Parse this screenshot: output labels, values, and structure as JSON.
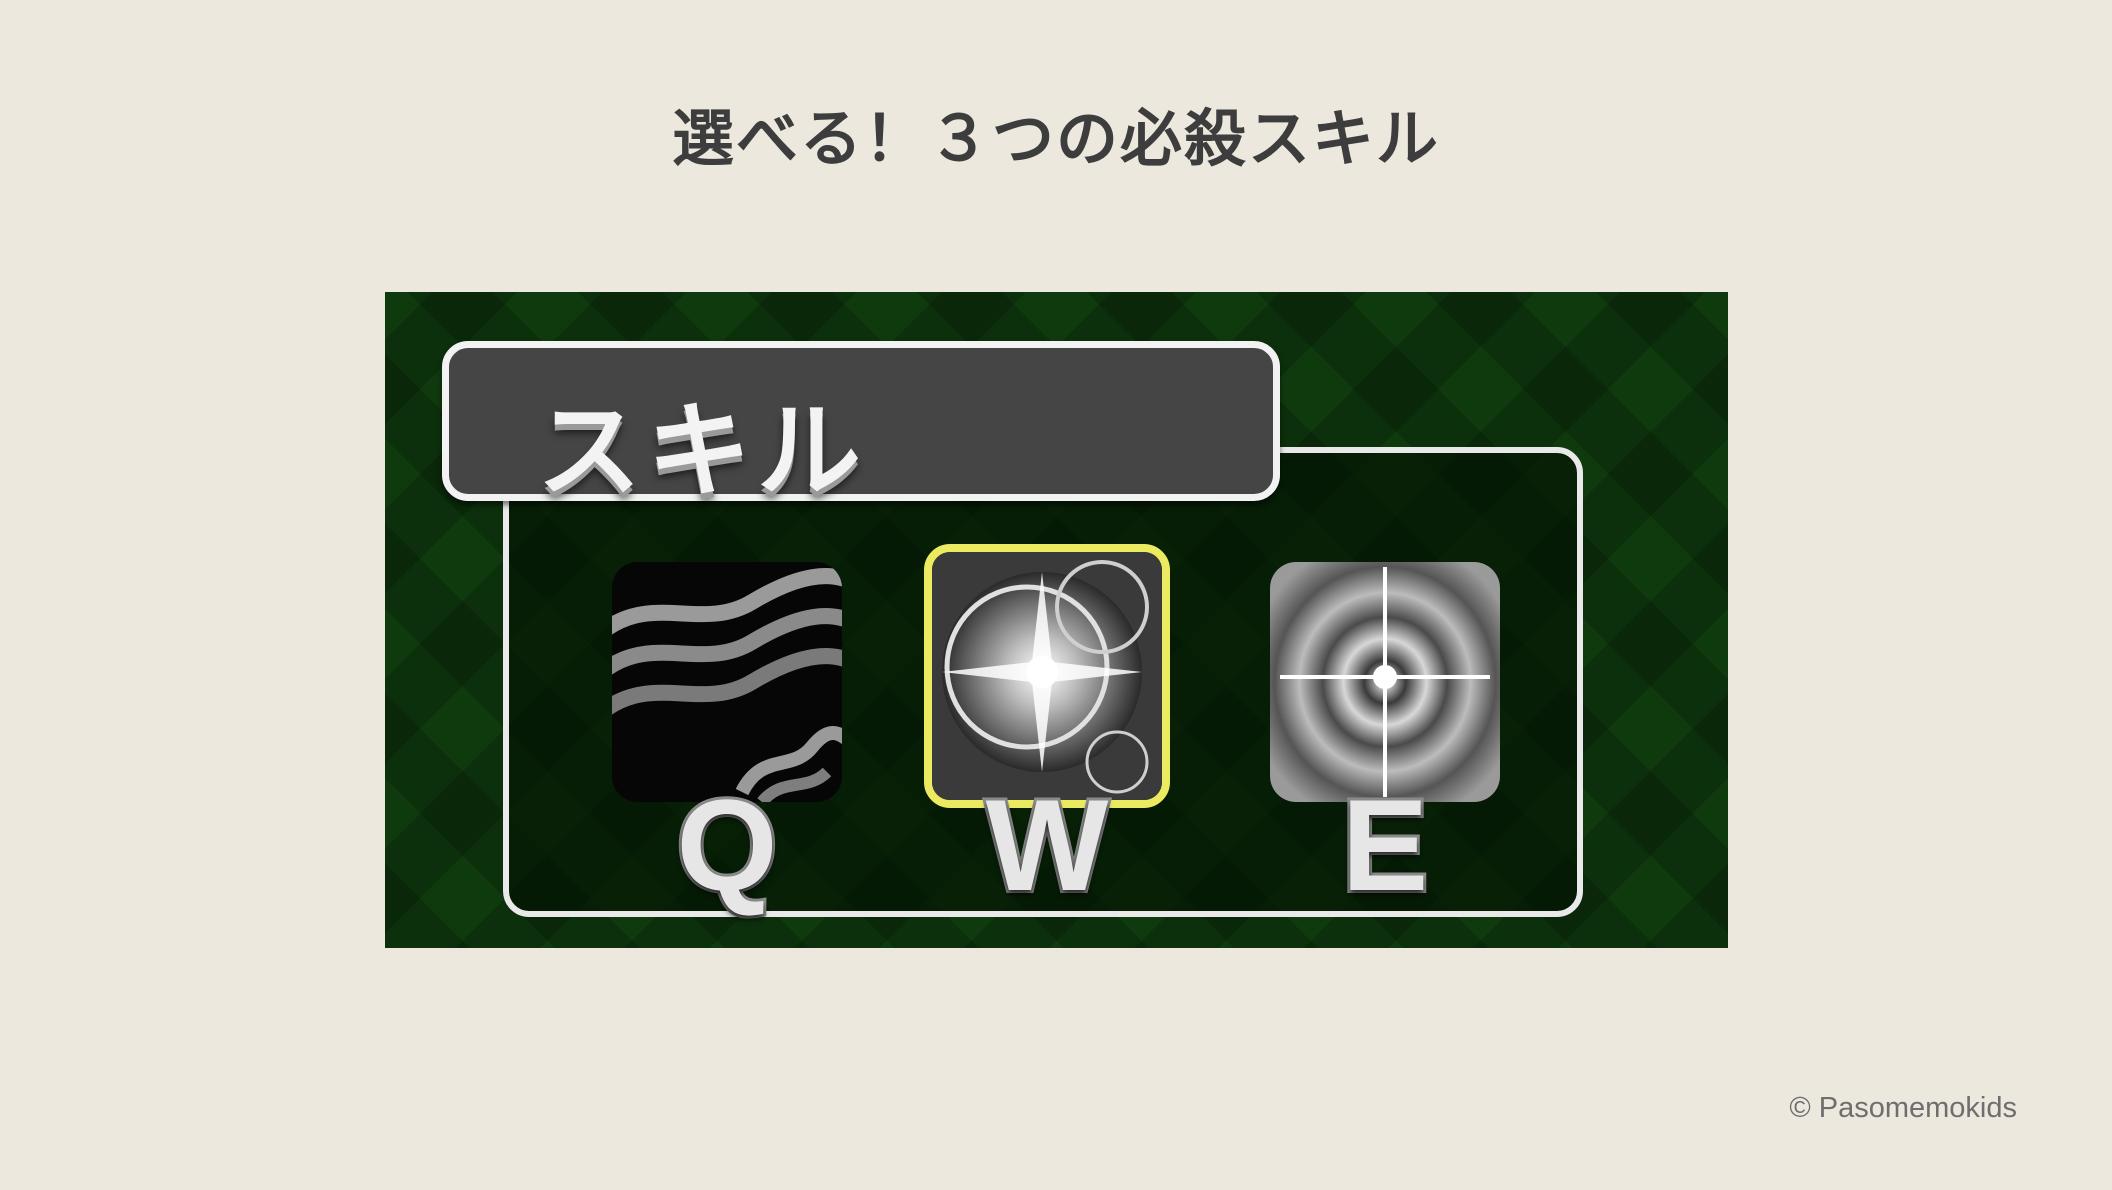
{
  "page": {
    "title": "選べる！３つの必殺スキル",
    "copyright": "©  Pasomemokids"
  },
  "game": {
    "header_label": "スキル",
    "skills": [
      {
        "key": "Q",
        "icon": "wave-stripes-icon",
        "selected": false
      },
      {
        "key": "W",
        "icon": "light-burst-icon",
        "selected": true
      },
      {
        "key": "E",
        "icon": "target-star-icon",
        "selected": false
      }
    ],
    "colors": {
      "background": "#ece8de",
      "panel": "#0f3a0e",
      "header_fill": "#454545",
      "selected_border": "#ecea60"
    }
  }
}
